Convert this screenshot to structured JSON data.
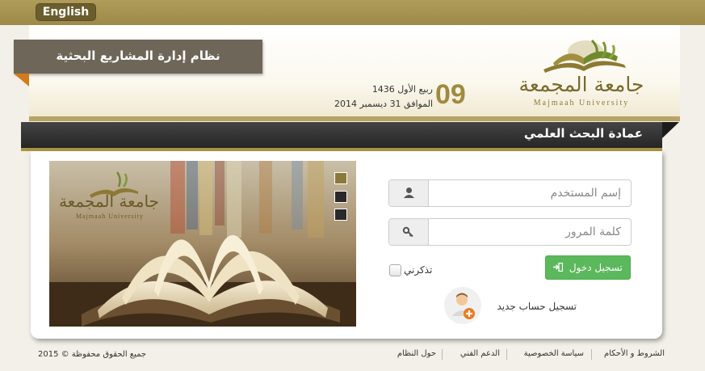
{
  "topbar": {
    "language_button": "English"
  },
  "header": {
    "system_title": "نظام إدارة المشاريع البحثية",
    "date_day": "09",
    "date_hijri": "ربيع الأول 1436",
    "date_gregorian": "الموافق 31 ديسمبر 2014",
    "logo_arabic": "جامعة المجمعة",
    "logo_english": "Majmaah University"
  },
  "section": {
    "title": "عمادة البحث العلمي"
  },
  "slider": {
    "logo_arabic": "جامعة المجمعة",
    "logo_english": "Majmaah University",
    "dots": 3
  },
  "login": {
    "username_placeholder": "إسم المستخدم",
    "password_placeholder": "كلمة المرور",
    "login_button": "تسجيل دخول",
    "remember_me": "تذكرني",
    "register": "تسجيل حساب جديد"
  },
  "footer": {
    "copyright": "جميع الحقوق محفوظة © 2015",
    "links": [
      "الشروط و الأحكام",
      "سياسة الخصوصية",
      "الدعم الفني",
      "حول النظام"
    ]
  },
  "colors": {
    "gold": "#a08a3e",
    "dark_bar": "#262626",
    "banner": "#6e6658",
    "accent_orange": "#d47a1e",
    "success": "#5cb85c"
  }
}
